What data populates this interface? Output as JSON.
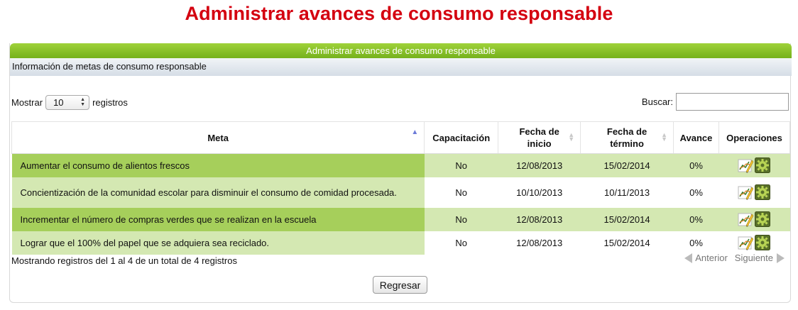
{
  "page": {
    "title": "Administrar avances de consumo responsable"
  },
  "panel": {
    "header": "Administrar avances de consumo responsable",
    "subheader": "Información de metas de consumo responsable"
  },
  "length_menu": {
    "prefix": "Mostrar",
    "selected": "10",
    "suffix": "registros"
  },
  "search": {
    "label": "Buscar:",
    "value": ""
  },
  "table": {
    "columns": [
      {
        "label": "Meta",
        "sorted": "ascending"
      },
      {
        "label": "Capacitación"
      },
      {
        "label": "Fecha de inicio"
      },
      {
        "label": "Fecha de término"
      },
      {
        "label": "Avance"
      },
      {
        "label": "Operaciones"
      }
    ],
    "rows": [
      {
        "meta": "Aumentar el consumo de alientos frescos",
        "capacitacion": "No",
        "inicio": "12/08/2013",
        "termino": "15/02/2014",
        "avance": "0%"
      },
      {
        "meta": "Concientización de la comunidad escolar para disminuir el consumo de comidad procesada.",
        "capacitacion": "No",
        "inicio": "10/10/2013",
        "termino": "10/11/2013",
        "avance": "0%"
      },
      {
        "meta": "Incrementar el número de compras verdes que se realizan en la escuela",
        "capacitacion": "No",
        "inicio": "12/08/2013",
        "termino": "15/02/2014",
        "avance": "0%"
      },
      {
        "meta": "Lograr que el 100% del papel que se adquiera sea reciclado.",
        "capacitacion": "No",
        "inicio": "12/08/2013",
        "termino": "15/02/2014",
        "avance": "0%"
      }
    ],
    "operations_icons": [
      "edit-chart-icon",
      "settings-gear-icon"
    ]
  },
  "footer": {
    "info": "Mostrando registros del 1 al 4 de un total de 4 registros",
    "previous": "Anterior",
    "next": "Siguiente",
    "back_button": "Regresar"
  },
  "colors": {
    "title": "#d40010",
    "header_green": "#8cc63f",
    "row_dark": "#a6cf5b",
    "row_light": "#d4e8b2"
  }
}
